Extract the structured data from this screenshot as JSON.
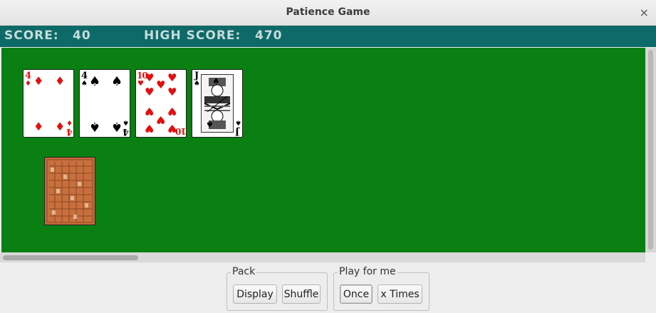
{
  "window": {
    "title": "Patience Game",
    "close_glyph": "×"
  },
  "score": {
    "score_label": "SCORE:",
    "score_value": "40",
    "high_label": "HIGH SCORE:",
    "high_value": "470"
  },
  "cards": [
    {
      "rank": "4",
      "suit": "diamonds"
    },
    {
      "rank": "4",
      "suit": "spades"
    },
    {
      "rank": "10",
      "suit": "hearts"
    },
    {
      "rank": "J",
      "suit": "spades"
    }
  ],
  "deck": {
    "face": "down"
  },
  "pack_group": {
    "legend": "Pack",
    "display": "Display",
    "shuffle": "Shuffle"
  },
  "play_group": {
    "legend": "Play for me",
    "once": "Once",
    "x_times": "x Times"
  },
  "colors": {
    "table": "#0a7f12",
    "score_bar": "#0d6a68",
    "red_suit": "#e01010"
  }
}
